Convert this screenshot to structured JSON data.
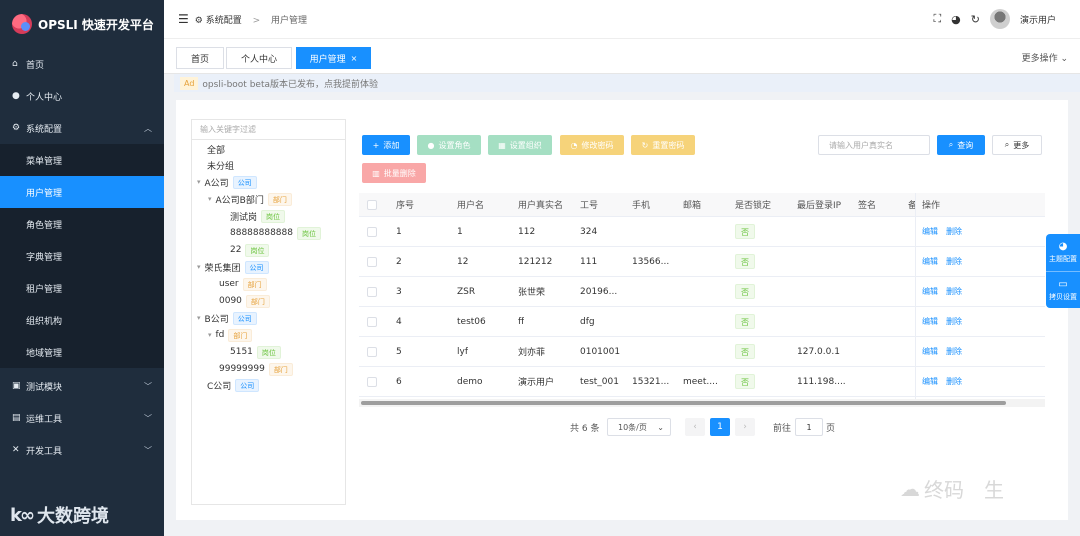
{
  "app": {
    "title": "OPSLI 快速开发平台"
  },
  "sidebar": {
    "items": [
      {
        "icon": "home-icon",
        "glyph": "⌂",
        "label": "首页"
      },
      {
        "icon": "user-icon",
        "glyph": "●",
        "label": "个人中心"
      },
      {
        "icon": "gear-icon",
        "glyph": "⚙",
        "label": "系统配置",
        "expanded": true
      },
      {
        "icon": "monitor-icon",
        "glyph": "▣",
        "label": "测试模块"
      },
      {
        "icon": "terminal-icon",
        "glyph": "▤",
        "label": "运维工具"
      },
      {
        "icon": "tools-icon",
        "glyph": "✕",
        "label": "开发工具"
      }
    ],
    "submenu": [
      "菜单管理",
      "用户管理",
      "角色管理",
      "字典管理",
      "租户管理",
      "组织机构",
      "地域管理"
    ],
    "active_sub": "用户管理",
    "watermark": "大数跨境"
  },
  "header": {
    "breadcrumb": [
      "系统配置",
      "用户管理"
    ],
    "username": "演示用户"
  },
  "tabs": [
    {
      "label": "首页",
      "active": false
    },
    {
      "label": "个人中心",
      "active": false
    },
    {
      "label": "用户管理",
      "active": true,
      "close": "×"
    }
  ],
  "more_ops": "更多操作",
  "notice": {
    "badge": "Ad",
    "text": "opsli-boot beta版本已发布，点我提前体验"
  },
  "tree": {
    "search_placeholder": "输入关键字过滤",
    "nodes": [
      {
        "label": "全部"
      },
      {
        "label": "未分组"
      },
      {
        "label": "A公司",
        "tag": "公司",
        "tagType": "company",
        "arrow": true
      },
      {
        "label": "A公司B部门",
        "tag": "部门",
        "tagType": "dept",
        "arrow": true
      },
      {
        "label": "测试岗",
        "tag": "岗位",
        "tagType": "post"
      },
      {
        "label": "88888888888",
        "tag": "岗位",
        "tagType": "post"
      },
      {
        "label": "22",
        "tag": "岗位",
        "tagType": "post"
      },
      {
        "label": "荣氏集团",
        "tag": "公司",
        "tagType": "company",
        "arrow": true
      },
      {
        "label": "user",
        "tag": "部门",
        "tagType": "dept"
      },
      {
        "label": "0090",
        "tag": "部门",
        "tagType": "dept"
      },
      {
        "label": "B公司",
        "tag": "公司",
        "tagType": "company",
        "arrow": true
      },
      {
        "label": "fd",
        "tag": "部门",
        "tagType": "dept",
        "arrow": true
      },
      {
        "label": "5151",
        "tag": "岗位",
        "tagType": "post"
      },
      {
        "label": "99999999",
        "tag": "部门",
        "tagType": "dept"
      },
      {
        "label": "C公司",
        "tag": "公司",
        "tagType": "company"
      }
    ]
  },
  "toolbar": {
    "add": "添加",
    "set_role": "设置角色",
    "set_org": "设置组织",
    "change_pwd": "修改密码",
    "reset_pwd": "重置密码",
    "batch_delete": "批量删除",
    "search_placeholder": "请输入用户真实名",
    "query": "查询",
    "more": "更多"
  },
  "table": {
    "headers": [
      "序号",
      "用户名",
      "用户真实名",
      "工号",
      "手机",
      "邮箱",
      "是否锁定",
      "最后登录IP",
      "签名",
      "备",
      "操作"
    ],
    "rows": [
      [
        "1",
        "1",
        "112",
        "324",
        "",
        "",
        "否",
        "",
        "",
        "",
        ""
      ],
      [
        "2",
        "12",
        "121212",
        "111",
        "13566...",
        "",
        "否",
        "",
        "",
        "",
        ""
      ],
      [
        "3",
        "ZSR",
        "张世荣",
        "20196...",
        "",
        "",
        "否",
        "",
        "",
        "",
        ""
      ],
      [
        "4",
        "test06",
        "ff",
        "dfg",
        "",
        "",
        "否",
        "",
        "",
        "",
        ""
      ],
      [
        "5",
        "lyf",
        "刘亦菲",
        "0101001",
        "",
        "",
        "否",
        "127.0.0.1",
        "",
        "",
        ""
      ],
      [
        "6",
        "demo",
        "演示用户",
        "test_001",
        "15321...",
        "meet....",
        "否",
        "111.198....",
        "",
        "",
        ""
      ]
    ],
    "edit": "编辑",
    "delete": "删除"
  },
  "pagination": {
    "total": "共 6 条",
    "page_size": "10条/页",
    "current": "1",
    "goto_prefix": "前往",
    "goto_value": "1",
    "goto_suffix": "页"
  },
  "float": {
    "theme": "主题配置",
    "copy": "拷贝设置"
  },
  "watermark_right": "终码　生"
}
